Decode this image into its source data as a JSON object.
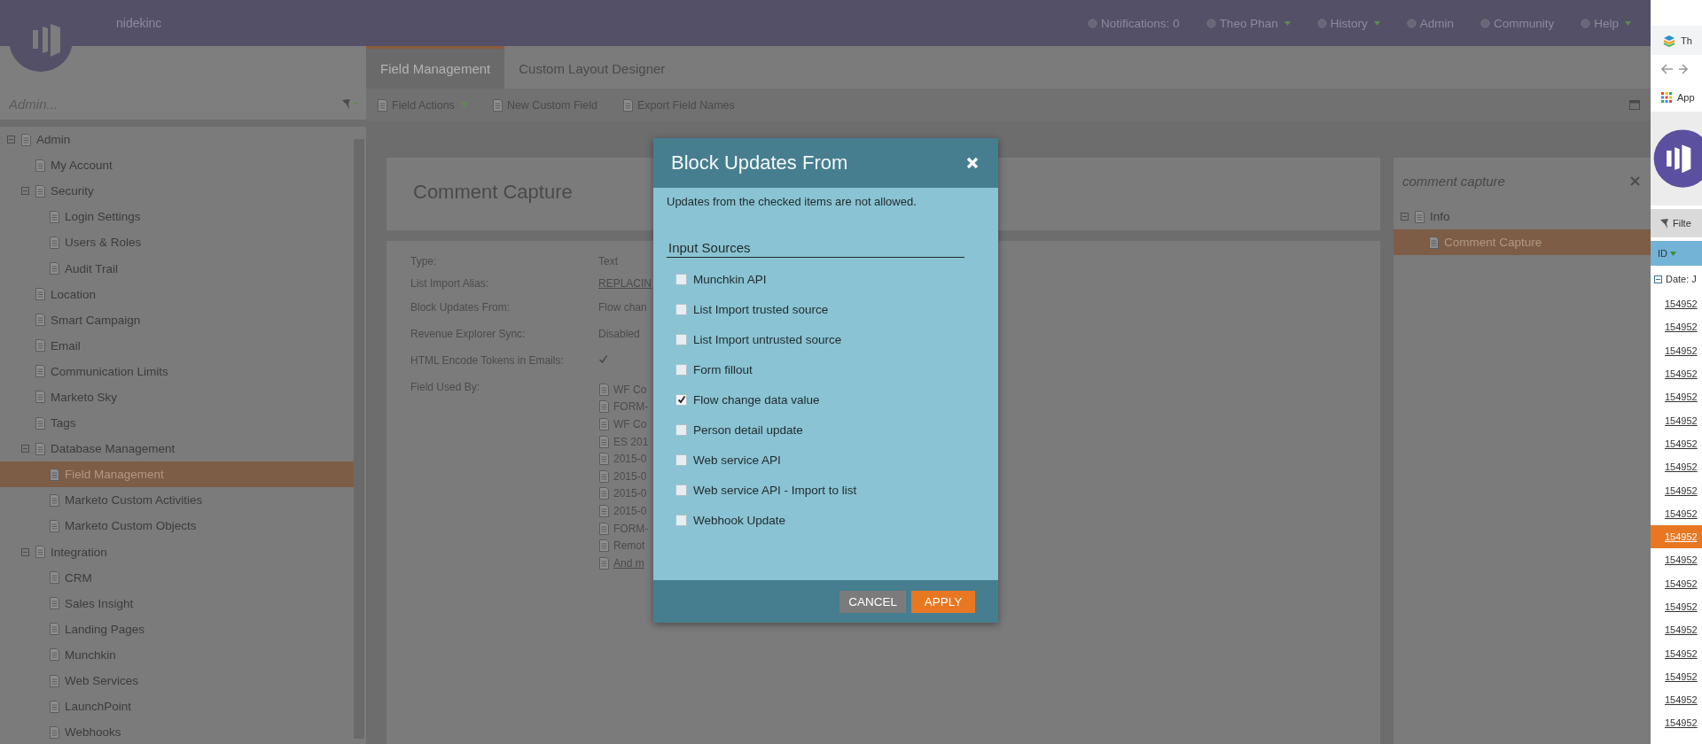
{
  "header": {
    "org": "nidekinc",
    "items": [
      {
        "label": "Notifications: 0",
        "dropdown": false
      },
      {
        "label": "Theo Phan",
        "dropdown": true
      },
      {
        "label": "History",
        "dropdown": true
      },
      {
        "label": "Admin",
        "dropdown": false
      },
      {
        "label": "Community",
        "dropdown": false
      },
      {
        "label": "Help",
        "dropdown": true
      }
    ]
  },
  "sidebar": {
    "search": {
      "placeholder": "Admin..."
    },
    "tree": [
      {
        "label": "Admin",
        "selected": false,
        "expanded": true,
        "children": [
          {
            "label": "My Account",
            "selected": false
          },
          {
            "label": "Security",
            "selected": false,
            "expanded": true,
            "children": [
              {
                "label": "Login Settings",
                "selected": false
              },
              {
                "label": "Users & Roles",
                "selected": false
              },
              {
                "label": "Audit Trail",
                "selected": false
              }
            ]
          },
          {
            "label": "Location",
            "selected": false
          },
          {
            "label": "Smart Campaign",
            "selected": false
          },
          {
            "label": "Email",
            "selected": false
          },
          {
            "label": "Communication Limits",
            "selected": false
          },
          {
            "label": "Marketo Sky",
            "selected": false
          },
          {
            "label": "Tags",
            "selected": false
          },
          {
            "label": "Database Management",
            "selected": false,
            "expanded": true,
            "children": [
              {
                "label": "Field Management",
                "selected": true
              },
              {
                "label": "Marketo Custom Activities",
                "selected": false
              },
              {
                "label": "Marketo Custom Objects",
                "selected": false
              }
            ]
          },
          {
            "label": "Integration",
            "selected": false,
            "expanded": true,
            "children": [
              {
                "label": "CRM",
                "selected": false
              },
              {
                "label": "Sales Insight",
                "selected": false
              },
              {
                "label": "Landing Pages",
                "selected": false
              },
              {
                "label": "Munchkin",
                "selected": false
              },
              {
                "label": "Web Services",
                "selected": false
              },
              {
                "label": "LaunchPoint",
                "selected": false
              },
              {
                "label": "Webhooks",
                "selected": false
              }
            ]
          }
        ]
      }
    ]
  },
  "tabs": [
    {
      "label": "Field Management",
      "selected": true
    },
    {
      "label": "Custom Layout Designer",
      "selected": false
    }
  ],
  "toolbar": [
    {
      "label": "Field Actions",
      "dropdown": true
    },
    {
      "label": "New Custom Field",
      "dropdown": false
    },
    {
      "label": "Export Field Names",
      "dropdown": false
    }
  ],
  "field": {
    "title": "Comment Capture",
    "properties": [
      {
        "label": "Type:",
        "kind": "text",
        "value": "Text"
      },
      {
        "label": "List Import Alias:",
        "kind": "link",
        "value": "REPLACIN"
      },
      {
        "label": "Block Updates From:",
        "kind": "text",
        "value": "Flow chan"
      },
      {
        "label": "Revenue Explorer Sync:",
        "kind": "text",
        "value": "Disabled"
      },
      {
        "label": "HTML Encode Tokens in Emails:",
        "kind": "checkbox",
        "checked": true
      },
      {
        "label": "Field Used By:",
        "kind": "list",
        "items": [
          {
            "text": "WF Co",
            "kind": "item"
          },
          {
            "text": "FORM-",
            "kind": "item"
          },
          {
            "text": "WF Co",
            "kind": "item"
          },
          {
            "text": "ES 201",
            "kind": "item"
          },
          {
            "text": "2015-0",
            "kind": "item"
          },
          {
            "text": "2015-0",
            "kind": "item"
          },
          {
            "text": "2015-0",
            "kind": "item"
          },
          {
            "text": "2015-0",
            "kind": "item"
          },
          {
            "text": "FORM-",
            "kind": "item"
          },
          {
            "text": "Remot",
            "kind": "item"
          },
          {
            "text": "And m",
            "kind": "link"
          }
        ]
      }
    ]
  },
  "details_panel": {
    "title": "comment capture",
    "tree": [
      {
        "label": "Info",
        "selected": false,
        "expanded": true,
        "children": [
          {
            "label": "Comment Capture",
            "selected": true
          }
        ]
      }
    ]
  },
  "dialog": {
    "title": "Block Updates From",
    "message": "Updates from the checked items are not allowed.",
    "section": "Input Sources",
    "options": [
      {
        "label": "Munchkin API",
        "checked": false
      },
      {
        "label": "List Import trusted source",
        "checked": false
      },
      {
        "label": "List Import untrusted source",
        "checked": false
      },
      {
        "label": "Form fillout",
        "checked": false
      },
      {
        "label": "Flow change data value",
        "checked": true
      },
      {
        "label": "Person detail update",
        "checked": false
      },
      {
        "label": "Web service API",
        "checked": false
      },
      {
        "label": "Web service API - Import to list",
        "checked": false
      },
      {
        "label": "Webhook Update",
        "checked": false
      }
    ],
    "buttons": [
      {
        "label": "CANCEL",
        "kind": "secondary"
      },
      {
        "label": "APPLY",
        "kind": "primary"
      }
    ]
  },
  "browser": {
    "tab_title": "Th",
    "bookmark": "App",
    "filter": "Filte",
    "column": "ID",
    "group": "Date: J",
    "rows": [
      {
        "id": "154952",
        "selected": false
      },
      {
        "id": "154952",
        "selected": false
      },
      {
        "id": "154952",
        "selected": false
      },
      {
        "id": "154952",
        "selected": false
      },
      {
        "id": "154952",
        "selected": false
      },
      {
        "id": "154952",
        "selected": false
      },
      {
        "id": "154952",
        "selected": false
      },
      {
        "id": "154952",
        "selected": false
      },
      {
        "id": "154952",
        "selected": false
      },
      {
        "id": "154952",
        "selected": false
      },
      {
        "id": "154952",
        "selected": true
      },
      {
        "id": "154952",
        "selected": false
      },
      {
        "id": "154952",
        "selected": false
      },
      {
        "id": "154952",
        "selected": false
      },
      {
        "id": "154952",
        "selected": false
      },
      {
        "id": "154952",
        "selected": false
      },
      {
        "id": "154952",
        "selected": false
      },
      {
        "id": "154952",
        "selected": false
      },
      {
        "id": "154952",
        "selected": false
      }
    ]
  }
}
